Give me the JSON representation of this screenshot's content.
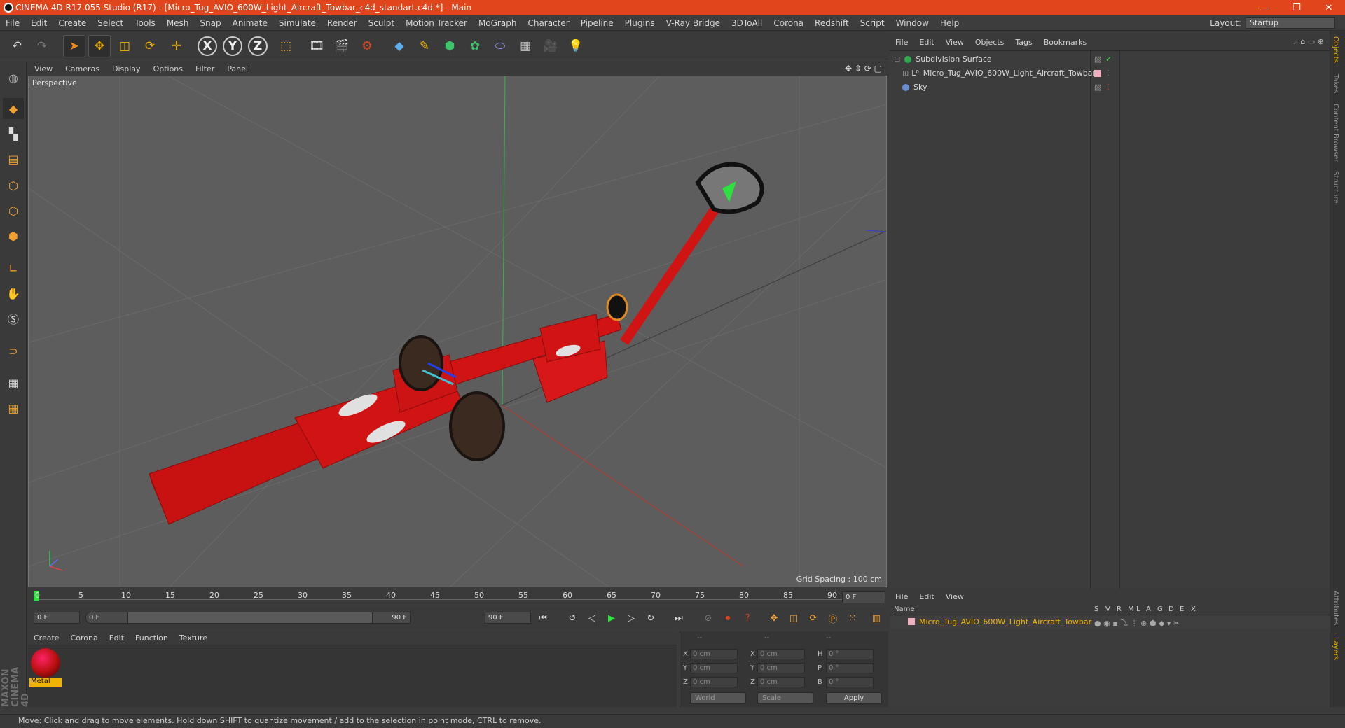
{
  "window": {
    "title": "CINEMA 4D R17.055 Studio (R17) - [Micro_Tug_AVIO_600W_Light_Aircraft_Towbar_c4d_standart.c4d *] - Main",
    "controls": [
      "—",
      "❐",
      "✕"
    ]
  },
  "menubar": {
    "items": [
      "File",
      "Edit",
      "Create",
      "Select",
      "Tools",
      "Mesh",
      "Snap",
      "Animate",
      "Simulate",
      "Render",
      "Sculpt",
      "Motion Tracker",
      "MoGraph",
      "Character",
      "Pipeline",
      "Plugins",
      "V-Ray Bridge",
      "3DToAll",
      "Corona",
      "Redshift",
      "Script",
      "Window",
      "Help"
    ],
    "layout_label": "Layout:",
    "layout_value": "Startup"
  },
  "toolbar": {
    "icons": [
      "undo-icon",
      "redo-icon",
      "select-icon",
      "move-icon",
      "scale-icon",
      "rotate-icon",
      "transform-icon",
      "x-axis-icon",
      "y-axis-icon",
      "z-axis-icon",
      "coord-system-icon",
      "render-view-icon",
      "render-picture-icon",
      "render-settings-icon",
      "cube-icon",
      "pen-icon",
      "subdivision-icon",
      "array-icon",
      "deformer-icon",
      "floor-icon",
      "camera-icon",
      "light-icon"
    ],
    "axis_labels": [
      "X",
      "Y",
      "Z"
    ]
  },
  "viewport": {
    "menu": [
      "View",
      "Cameras",
      "Display",
      "Options",
      "Filter",
      "Panel"
    ],
    "label": "Perspective",
    "grid_spacing": "Grid Spacing : 100 cm"
  },
  "timeline": {
    "ticks": [
      "0",
      "5",
      "10",
      "15",
      "20",
      "25",
      "30",
      "35",
      "40",
      "45",
      "50",
      "55",
      "60",
      "65",
      "70",
      "75",
      "80",
      "85",
      "90"
    ],
    "current_frame": "0 F",
    "start": "0 F",
    "range_start": "0 F",
    "range_end": "90 F",
    "end": "90 F"
  },
  "material_manager": {
    "menu": [
      "Create",
      "Corona",
      "Edit",
      "Function",
      "Texture"
    ],
    "material_name": "Metal"
  },
  "coordinates": {
    "header": [
      "--",
      "--",
      "--"
    ],
    "rows": [
      {
        "a": "X",
        "av": "0 cm",
        "b": "X",
        "bv": "0 cm",
        "c": "H",
        "cv": "0 °"
      },
      {
        "a": "Y",
        "av": "0 cm",
        "b": "Y",
        "bv": "0 cm",
        "c": "P",
        "cv": "0 °"
      },
      {
        "a": "Z",
        "av": "0 cm",
        "b": "Z",
        "bv": "0 cm",
        "c": "B",
        "cv": "0 °"
      }
    ],
    "mode1": "World",
    "mode2": "Scale",
    "apply": "Apply"
  },
  "object_manager": {
    "menu": [
      "File",
      "Edit",
      "View",
      "Objects",
      "Tags",
      "Bookmarks"
    ],
    "objects": [
      {
        "name": "Subdivision Surface",
        "color": "#2fa84f"
      },
      {
        "name": "Micro_Tug_AVIO_600W_Light_Aircraft_Towbar",
        "color": "#dddddd"
      },
      {
        "name": "Sky",
        "color": "#6a8fd0"
      }
    ]
  },
  "layer_manager": {
    "menu": [
      "File",
      "Edit",
      "View"
    ],
    "name_header": "Name",
    "flags": [
      "S",
      "V",
      "R",
      "M",
      "L",
      "A",
      "G",
      "D",
      "E",
      "X"
    ],
    "layer_name": "Micro_Tug_AVIO_600W_Light_Aircraft_Towbar"
  },
  "right_tabs": [
    "Objects",
    "Takes",
    "Content Browser",
    "Structure"
  ],
  "right_tabs_bottom": [
    "Attributes",
    "Layers"
  ],
  "branding": "MAXON CINEMA 4D",
  "statusbar": {
    "text": "Move: Click and drag to move elements. Hold down SHIFT to quantize movement / add to the selection in point mode, CTRL to remove."
  },
  "colors": {
    "accent": "#e0451c",
    "model_red": "#d01414",
    "material_label": "#f0b400"
  }
}
